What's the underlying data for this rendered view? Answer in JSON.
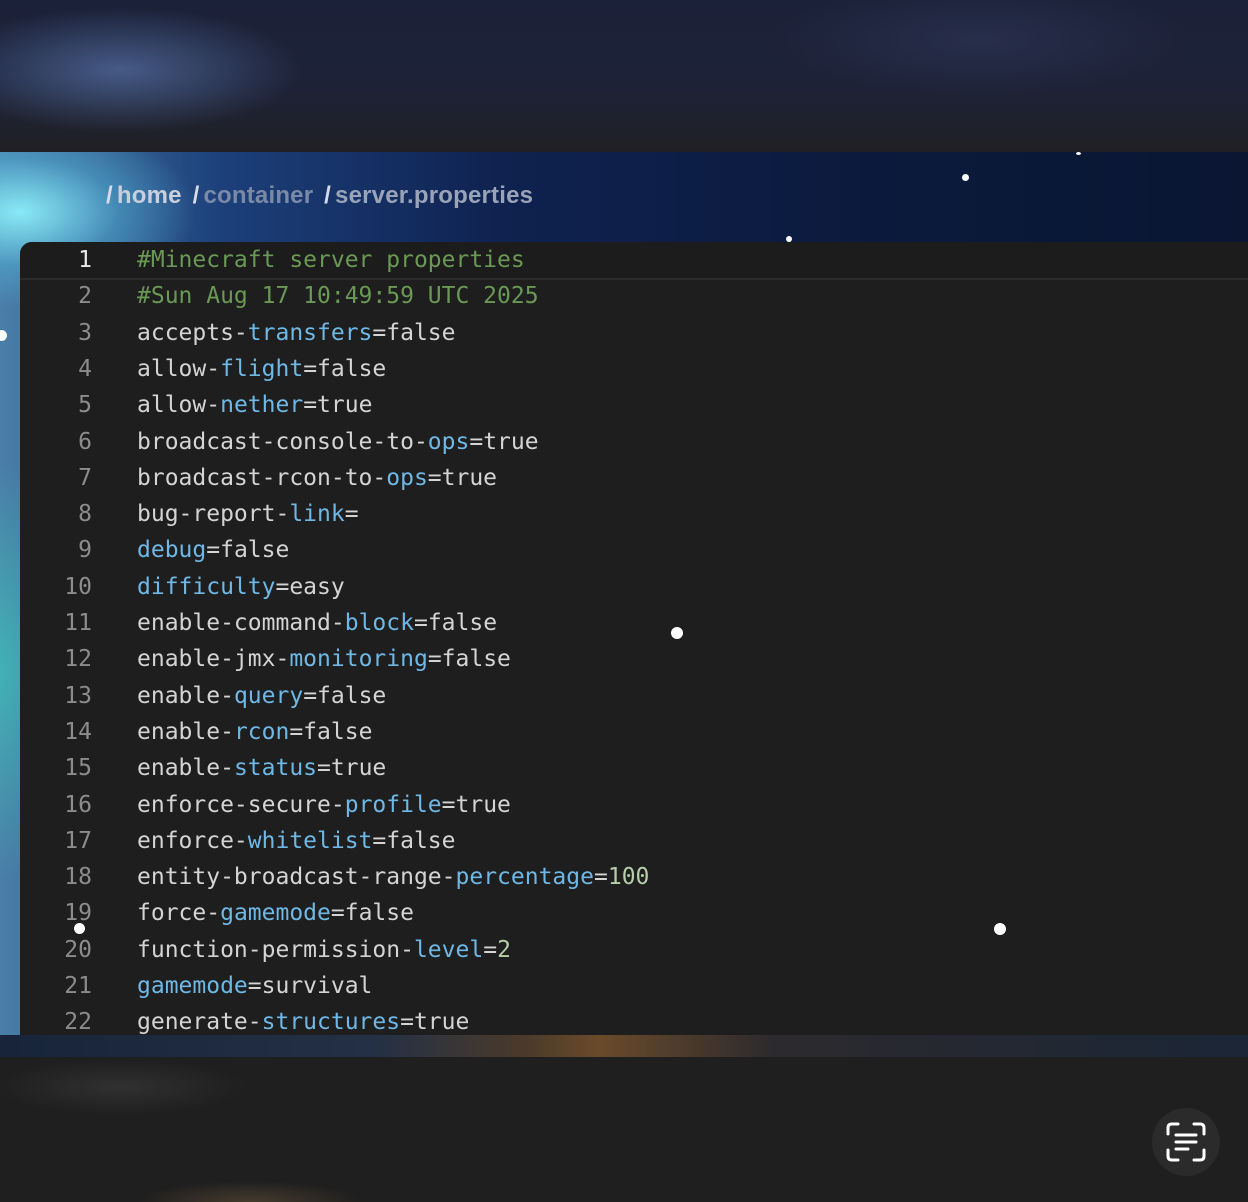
{
  "breadcrumb": {
    "segments": [
      "home",
      "container",
      "server.properties"
    ],
    "separator": "/"
  },
  "colors": {
    "comment": "#6a9955",
    "keyword": "#6fb8e6",
    "number": "#b5cea8",
    "text": "#d4d4d4",
    "line_number": "#8c8c8c"
  },
  "editor": {
    "active_line": 1,
    "lines": [
      {
        "num": "1",
        "tokens": [
          {
            "t": "#Minecraft server properties",
            "c": "comment"
          }
        ]
      },
      {
        "num": "2",
        "tokens": [
          {
            "t": "#Sun Aug 17 10:49:59 UTC 2025",
            "c": "comment"
          }
        ]
      },
      {
        "num": "3",
        "tokens": [
          {
            "t": "accepts-",
            "c": "key"
          },
          {
            "t": "transfers",
            "c": "kw"
          },
          {
            "t": "=false",
            "c": "val"
          }
        ]
      },
      {
        "num": "4",
        "tokens": [
          {
            "t": "allow-",
            "c": "key"
          },
          {
            "t": "flight",
            "c": "kw"
          },
          {
            "t": "=false",
            "c": "val"
          }
        ]
      },
      {
        "num": "5",
        "tokens": [
          {
            "t": "allow-",
            "c": "key"
          },
          {
            "t": "nether",
            "c": "kw"
          },
          {
            "t": "=true",
            "c": "val"
          }
        ]
      },
      {
        "num": "6",
        "tokens": [
          {
            "t": "broadcast-console-to-",
            "c": "key"
          },
          {
            "t": "ops",
            "c": "kw"
          },
          {
            "t": "=true",
            "c": "val"
          }
        ]
      },
      {
        "num": "7",
        "tokens": [
          {
            "t": "broadcast-rcon-to-",
            "c": "key"
          },
          {
            "t": "ops",
            "c": "kw"
          },
          {
            "t": "=true",
            "c": "val"
          }
        ]
      },
      {
        "num": "8",
        "tokens": [
          {
            "t": "bug-report-",
            "c": "key"
          },
          {
            "t": "link",
            "c": "kw"
          },
          {
            "t": "=",
            "c": "val"
          }
        ]
      },
      {
        "num": "9",
        "tokens": [
          {
            "t": "debug",
            "c": "kw"
          },
          {
            "t": "=false",
            "c": "val"
          }
        ]
      },
      {
        "num": "10",
        "tokens": [
          {
            "t": "difficulty",
            "c": "kw"
          },
          {
            "t": "=easy",
            "c": "val"
          }
        ]
      },
      {
        "num": "11",
        "tokens": [
          {
            "t": "enable-command-",
            "c": "key"
          },
          {
            "t": "block",
            "c": "kw"
          },
          {
            "t": "=false",
            "c": "val"
          }
        ]
      },
      {
        "num": "12",
        "tokens": [
          {
            "t": "enable-jmx-",
            "c": "key"
          },
          {
            "t": "monitoring",
            "c": "kw"
          },
          {
            "t": "=false",
            "c": "val"
          }
        ]
      },
      {
        "num": "13",
        "tokens": [
          {
            "t": "enable-",
            "c": "key"
          },
          {
            "t": "query",
            "c": "kw"
          },
          {
            "t": "=false",
            "c": "val"
          }
        ]
      },
      {
        "num": "14",
        "tokens": [
          {
            "t": "enable-",
            "c": "key"
          },
          {
            "t": "rcon",
            "c": "kw"
          },
          {
            "t": "=false",
            "c": "val"
          }
        ]
      },
      {
        "num": "15",
        "tokens": [
          {
            "t": "enable-",
            "c": "key"
          },
          {
            "t": "status",
            "c": "kw"
          },
          {
            "t": "=true",
            "c": "val"
          }
        ]
      },
      {
        "num": "16",
        "tokens": [
          {
            "t": "enforce-secure-",
            "c": "key"
          },
          {
            "t": "profile",
            "c": "kw"
          },
          {
            "t": "=true",
            "c": "val"
          }
        ]
      },
      {
        "num": "17",
        "tokens": [
          {
            "t": "enforce-",
            "c": "key"
          },
          {
            "t": "whitelist",
            "c": "kw"
          },
          {
            "t": "=false",
            "c": "val"
          }
        ]
      },
      {
        "num": "18",
        "tokens": [
          {
            "t": "entity-broadcast-range-",
            "c": "key"
          },
          {
            "t": "percentage",
            "c": "kw"
          },
          {
            "t": "=",
            "c": "val"
          },
          {
            "t": "100",
            "c": "num"
          }
        ]
      },
      {
        "num": "19",
        "tokens": [
          {
            "t": "force-",
            "c": "key"
          },
          {
            "t": "gamemode",
            "c": "kw"
          },
          {
            "t": "=false",
            "c": "val"
          }
        ]
      },
      {
        "num": "20",
        "tokens": [
          {
            "t": "function-permission-",
            "c": "key"
          },
          {
            "t": "level",
            "c": "kw"
          },
          {
            "t": "=",
            "c": "val"
          },
          {
            "t": "2",
            "c": "num"
          }
        ]
      },
      {
        "num": "21",
        "tokens": [
          {
            "t": "gamemode",
            "c": "kw"
          },
          {
            "t": "=survival",
            "c": "val"
          }
        ]
      },
      {
        "num": "22",
        "tokens": [
          {
            "t": "generate-",
            "c": "key"
          },
          {
            "t": "structures",
            "c": "kw"
          },
          {
            "t": "=true",
            "c": "val"
          }
        ]
      }
    ]
  },
  "toolbar": {
    "live_text_icon": "text-scan-icon"
  }
}
